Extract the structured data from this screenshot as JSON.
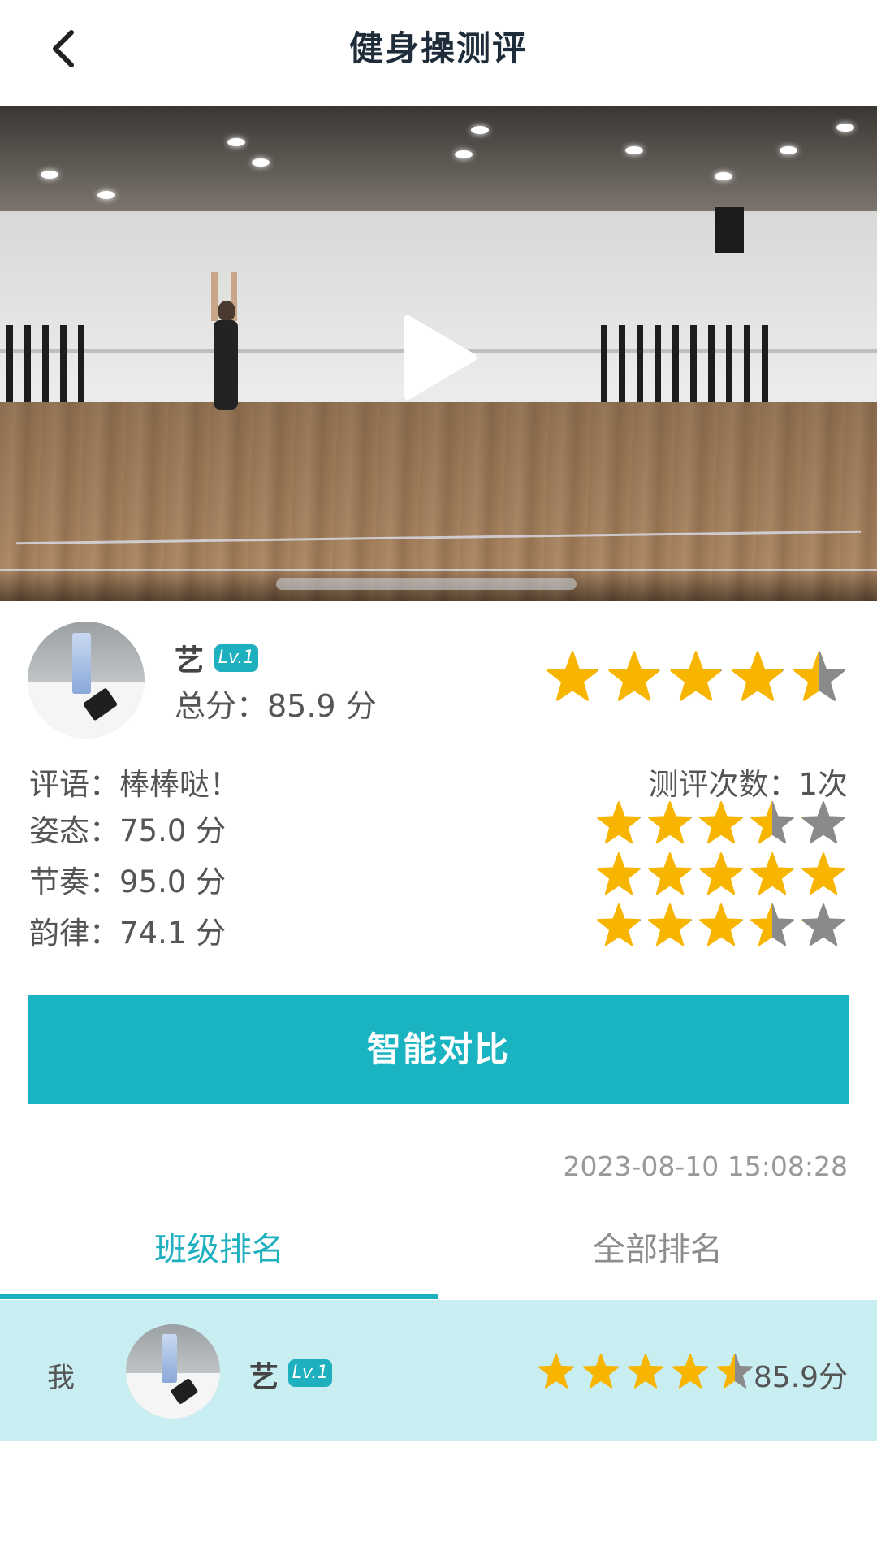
{
  "header": {
    "title": "健身操测评",
    "back_icon": "chevron-left-icon"
  },
  "video": {
    "play_icon": "play-icon"
  },
  "summary": {
    "username": "艺",
    "level": "Lv.1",
    "total_score_label": "总分：85.9 分",
    "total_rating": 4.5
  },
  "evaluation": {
    "comment": "评语：棒棒哒！",
    "count": "测评次数：1次",
    "metrics": [
      {
        "text": "姿态：75.0 分",
        "rating": 3.5
      },
      {
        "text": "节奏：95.0 分",
        "rating": 5
      },
      {
        "text": "韵律：74.1 分",
        "rating": 3.5
      }
    ]
  },
  "compare_button": "智能对比",
  "timestamp": "2023-08-10 15:08:28",
  "tabs": [
    {
      "label": "班级排名",
      "active": true
    },
    {
      "label": "全部排名",
      "active": false
    }
  ],
  "ranking": {
    "rows": [
      {
        "rank": "我",
        "name": "艺",
        "level": "Lv.1",
        "rating": 4.5,
        "score": "85.9分"
      }
    ]
  },
  "colors": {
    "accent": "#1fb0c0",
    "star_on": "#f7b500",
    "star_off": "#8a8a8a",
    "row_highlight": "#c9eef2"
  }
}
